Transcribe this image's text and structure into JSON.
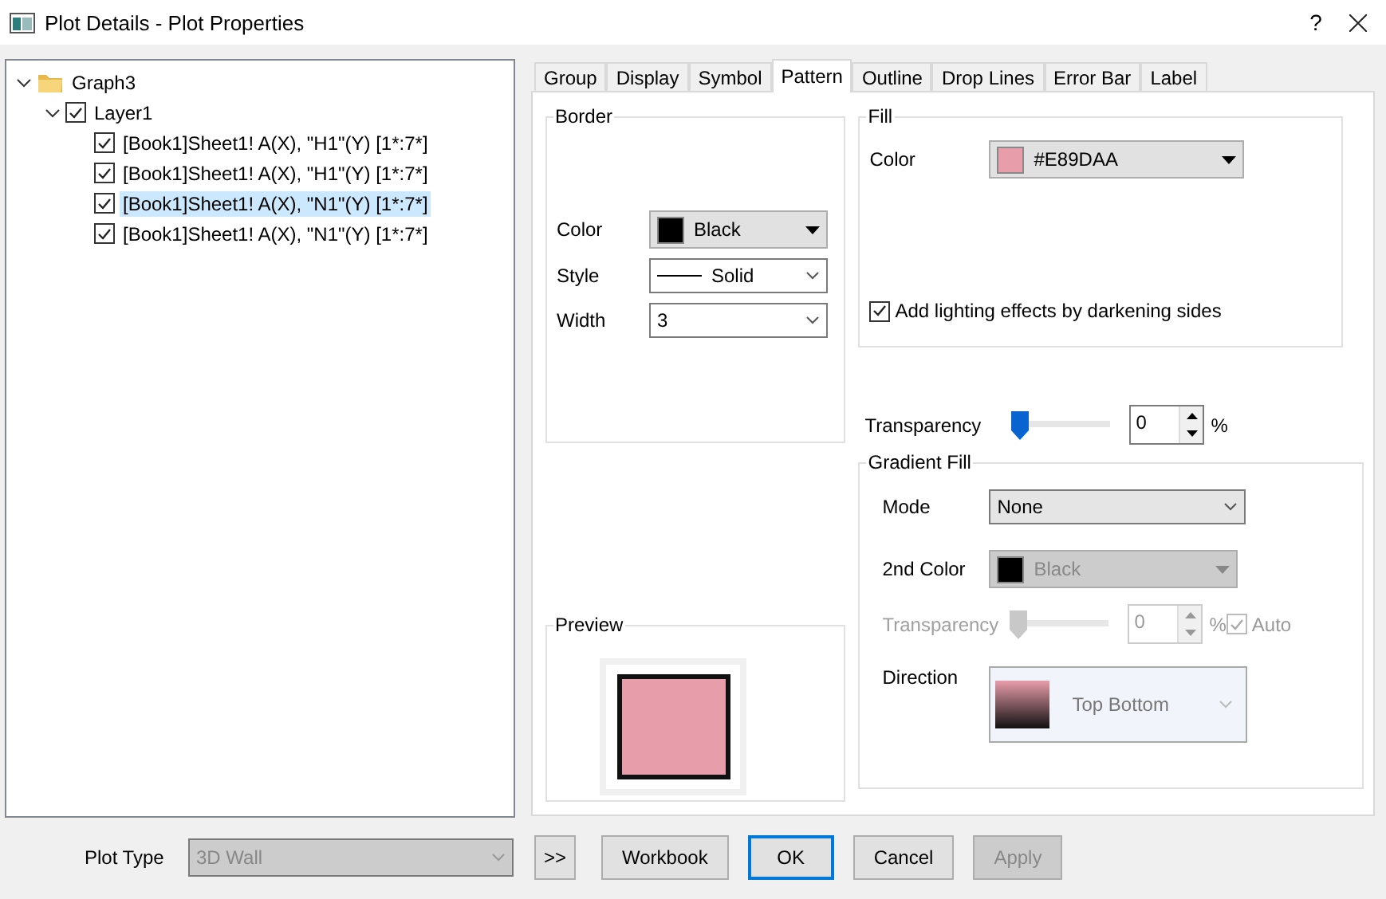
{
  "window": {
    "title": "Plot Details - Plot Properties",
    "help": "?"
  },
  "tree": [
    {
      "label": "Graph3",
      "kind": "folder",
      "expanded": true,
      "children": [
        {
          "label": "Layer1",
          "kind": "check",
          "checked": true,
          "expanded": true,
          "children": [
            {
              "label": "[Book1]Sheet1! A(X), \"H1\"(Y) [1*:7*]",
              "kind": "check",
              "checked": true,
              "selected": false
            },
            {
              "label": "[Book1]Sheet1! A(X), \"H1\"(Y) [1*:7*]",
              "kind": "check",
              "checked": true,
              "selected": false
            },
            {
              "label": "[Book1]Sheet1! A(X), \"N1\"(Y) [1*:7*]",
              "kind": "check",
              "checked": true,
              "selected": true
            },
            {
              "label": "[Book1]Sheet1! A(X), \"N1\"(Y) [1*:7*]",
              "kind": "check",
              "checked": true,
              "selected": false
            }
          ]
        }
      ]
    }
  ],
  "tabs": [
    {
      "label": "Group",
      "selected": false
    },
    {
      "label": "Display",
      "selected": false
    },
    {
      "label": "Symbol",
      "selected": false
    },
    {
      "label": "Pattern",
      "selected": true
    },
    {
      "label": "Outline",
      "selected": false
    },
    {
      "label": "Drop Lines",
      "selected": false
    },
    {
      "label": "Error Bar",
      "selected": false
    },
    {
      "label": "Label",
      "selected": false
    }
  ],
  "border": {
    "title": "Border",
    "fields": [
      {
        "label": "Color",
        "value": "Black",
        "kind": "color",
        "color": "#000000"
      },
      {
        "label": "Style",
        "value": "Solid",
        "kind": "line"
      },
      {
        "label": "Width",
        "value": "3",
        "kind": "plain"
      }
    ]
  },
  "fill": {
    "title": "Fill",
    "color_label": "Color",
    "color_value": "#E89DAA",
    "color": "#e89daa",
    "lighting": {
      "label": "Add lighting effects by darkening sides",
      "checked": true
    }
  },
  "transparency": {
    "label": "Transparency",
    "level": 0,
    "value": "0",
    "unit": "%"
  },
  "gradient": {
    "title": "Gradient Fill",
    "mode": {
      "label": "Mode",
      "value": "None"
    },
    "second_color": {
      "label": "2nd Color",
      "value": "Black",
      "color": "#000000",
      "disabled": true
    },
    "transparency": {
      "label": "Transparency",
      "level": 0,
      "value": "0",
      "unit": "%",
      "disabled": true,
      "auto": {
        "label": "Auto",
        "checked": true,
        "disabled": true
      }
    },
    "direction": {
      "label": "Direction",
      "value": "Top Bottom"
    }
  },
  "preview": {
    "title": "Preview"
  },
  "footer": {
    "plot_type": {
      "label": "Plot Type",
      "value": "3D Wall",
      "disabled": true
    },
    "buttons": [
      {
        "label": ">>",
        "kind": "small",
        "disabled": false,
        "default": false
      },
      {
        "label": "Workbook",
        "kind": "normal",
        "disabled": false,
        "default": false
      },
      {
        "label": "OK",
        "kind": "normal",
        "disabled": false,
        "default": true
      },
      {
        "label": "Cancel",
        "kind": "normal",
        "disabled": false,
        "default": false
      },
      {
        "label": "Apply",
        "kind": "normal",
        "disabled": true,
        "default": false
      }
    ]
  }
}
